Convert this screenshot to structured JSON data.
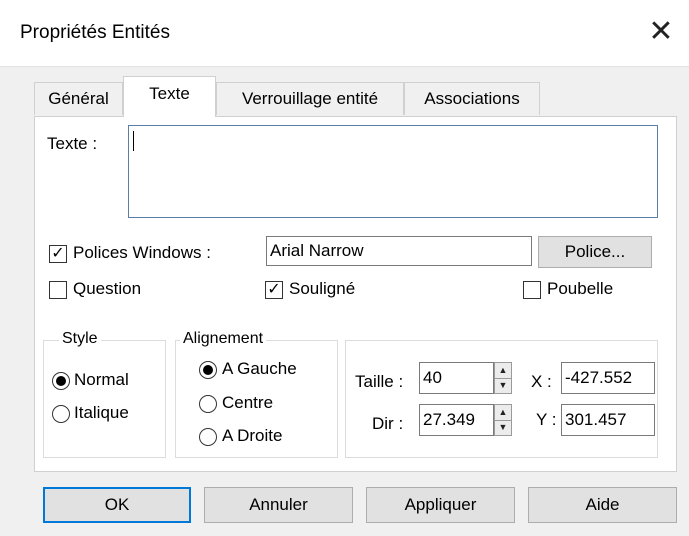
{
  "window": {
    "title": "Propriétés Entités",
    "close_glyph": "✕"
  },
  "tabs": [
    {
      "label": "Général"
    },
    {
      "label": "Texte"
    },
    {
      "label": "Verrouillage entité"
    },
    {
      "label": "Associations"
    }
  ],
  "texte": {
    "label": "Texte :",
    "value": ""
  },
  "polices_windows": {
    "label": "Polices Windows :",
    "checked": true,
    "font_value": "Arial Narrow",
    "button": "Police..."
  },
  "options": {
    "question": {
      "label": "Question",
      "checked": false
    },
    "souligne": {
      "label": "Souligné",
      "checked": true
    },
    "poubelle": {
      "label": "Poubelle",
      "checked": false
    }
  },
  "style": {
    "legend": "Style",
    "normal": "Normal",
    "italique": "Italique",
    "selected": "Normal"
  },
  "alignement": {
    "legend": "Alignement",
    "gauche": "A Gauche",
    "centre": "Centre",
    "droite": "A Droite",
    "selected": "A Gauche"
  },
  "geometry_fields": {
    "taille_label": "Taille :",
    "taille_value": "40",
    "dir_label": "Dir :",
    "dir_value": "27.349",
    "x_label": "X :",
    "x_value": "-427.552",
    "y_label": "Y :",
    "y_value": "301.457"
  },
  "buttons": {
    "ok": "OK",
    "annuler": "Annuler",
    "appliquer": "Appliquer",
    "aide": "Aide"
  },
  "colors": {
    "accent": "#0078d7",
    "dialog_bg": "#f0f0f0",
    "panel_bg": "#ffffff"
  }
}
